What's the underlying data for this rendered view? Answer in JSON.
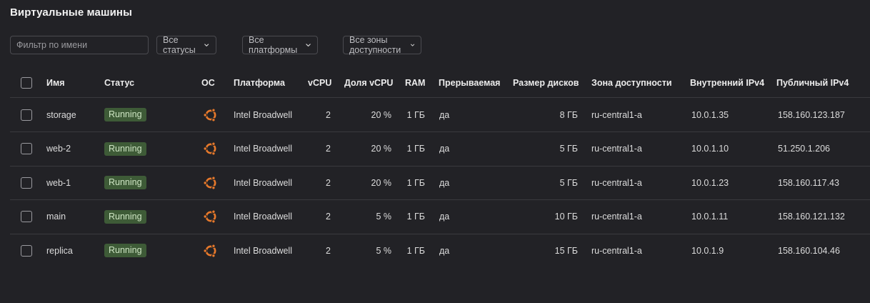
{
  "page": {
    "title": "Виртуальные машины"
  },
  "filters": {
    "name_placeholder": "Фильтр по имени",
    "status_label": "Все статусы",
    "platform_label": "Все платформы",
    "zone_label": "Все зоны доступности"
  },
  "table": {
    "columns": {
      "name": "Имя",
      "status": "Статус",
      "os": "ОС",
      "platform": "Платформа",
      "vcpu": "vCPU",
      "vcpu_share": "Доля vCPU",
      "ram": "RAM",
      "preemptible": "Прерываемая",
      "disk_size": "Размер дисков",
      "zone": "Зона доступности",
      "internal_ip": "Внутренний IPv4",
      "public_ip": "Публичный IPv4"
    },
    "rows": [
      {
        "name": "storage",
        "status": "Running",
        "os_icon": "ubuntu-icon",
        "platform": "Intel Broadwell",
        "vcpu": "2",
        "vcpu_share": "20 %",
        "ram": "1 ГБ",
        "preemptible": "да",
        "disk_size": "8 ГБ",
        "zone": "ru-central1-a",
        "internal_ip": "10.0.1.35",
        "public_ip": "158.160.123.187"
      },
      {
        "name": "web-2",
        "status": "Running",
        "os_icon": "ubuntu-icon",
        "platform": "Intel Broadwell",
        "vcpu": "2",
        "vcpu_share": "20 %",
        "ram": "1 ГБ",
        "preemptible": "да",
        "disk_size": "5 ГБ",
        "zone": "ru-central1-a",
        "internal_ip": "10.0.1.10",
        "public_ip": "51.250.1.206"
      },
      {
        "name": "web-1",
        "status": "Running",
        "os_icon": "ubuntu-icon",
        "platform": "Intel Broadwell",
        "vcpu": "2",
        "vcpu_share": "20 %",
        "ram": "1 ГБ",
        "preemptible": "да",
        "disk_size": "5 ГБ",
        "zone": "ru-central1-a",
        "internal_ip": "10.0.1.23",
        "public_ip": "158.160.117.43"
      },
      {
        "name": "main",
        "status": "Running",
        "os_icon": "ubuntu-icon",
        "platform": "Intel Broadwell",
        "vcpu": "2",
        "vcpu_share": "5 %",
        "ram": "1 ГБ",
        "preemptible": "да",
        "disk_size": "10 ГБ",
        "zone": "ru-central1-a",
        "internal_ip": "10.0.1.11",
        "public_ip": "158.160.121.132"
      },
      {
        "name": "replica",
        "status": "Running",
        "os_icon": "ubuntu-icon",
        "platform": "Intel Broadwell",
        "vcpu": "2",
        "vcpu_share": "5 %",
        "ram": "1 ГБ",
        "preemptible": "да",
        "disk_size": "15 ГБ",
        "zone": "ru-central1-a",
        "internal_ip": "10.0.1.9",
        "public_ip": "158.160.104.46"
      }
    ]
  },
  "colors": {
    "background": "#222226",
    "status_running_bg": "#3e5b37",
    "ubuntu_orange": "#e7792b"
  }
}
